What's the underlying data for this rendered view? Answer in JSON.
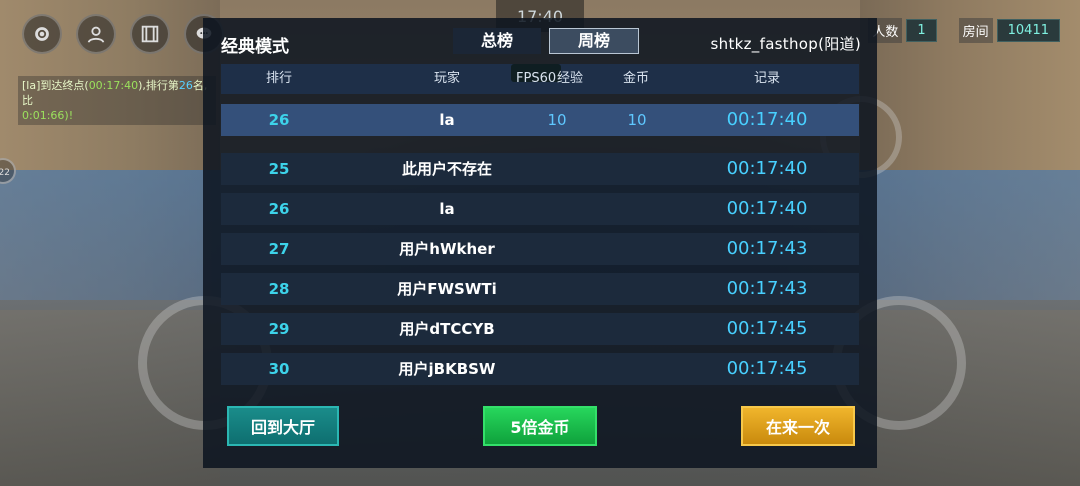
{
  "hud": {
    "timer": "17:40",
    "side_badge": "22",
    "chat_player": "[la]",
    "chat_text_1": "到达终点(",
    "chat_time": "00:17:40",
    "chat_text_2": "),排行第",
    "chat_rank": "26",
    "chat_text_3": "名,比",
    "chat_text_4": "0:01:66)!",
    "players_label": "人数",
    "players_value": "1",
    "room_label": "房间",
    "room_value": "10411"
  },
  "panel": {
    "title": "经典模式",
    "tabs": [
      {
        "label": "总榜",
        "active": false
      },
      {
        "label": "周榜",
        "active": true
      }
    ],
    "map_name": "shtkz_fasthop(阳道)",
    "fps": "FPS60",
    "columns": {
      "rank": "排行",
      "player": "玩家",
      "exp": "经验",
      "gold": "金币",
      "record": "记录"
    },
    "me": {
      "rank": "26",
      "name": "la",
      "exp": "10",
      "gold": "10",
      "time": "00:17:40"
    },
    "rows": [
      {
        "rank": "25",
        "name": "此用户不存在",
        "time": "00:17:40"
      },
      {
        "rank": "26",
        "name": "la",
        "time": "00:17:40"
      },
      {
        "rank": "27",
        "name": "用户hWkher",
        "time": "00:17:43"
      },
      {
        "rank": "28",
        "name": "用户FWSWTi",
        "time": "00:17:43"
      },
      {
        "rank": "29",
        "name": "用户dTCCYB",
        "time": "00:17:45"
      },
      {
        "rank": "30",
        "name": "用户jBKBSW",
        "time": "00:17:45"
      }
    ],
    "buttons": {
      "lobby": "回到大厅",
      "gold": "5倍金币",
      "again": "在来一次"
    }
  },
  "colors": {
    "accent_cyan": "#48d0ff",
    "rank_cyan": "#3dd3ea",
    "btn_lobby": "#0e6f70",
    "btn_gold": "#0fa23c",
    "btn_again": "#c98a0d"
  }
}
